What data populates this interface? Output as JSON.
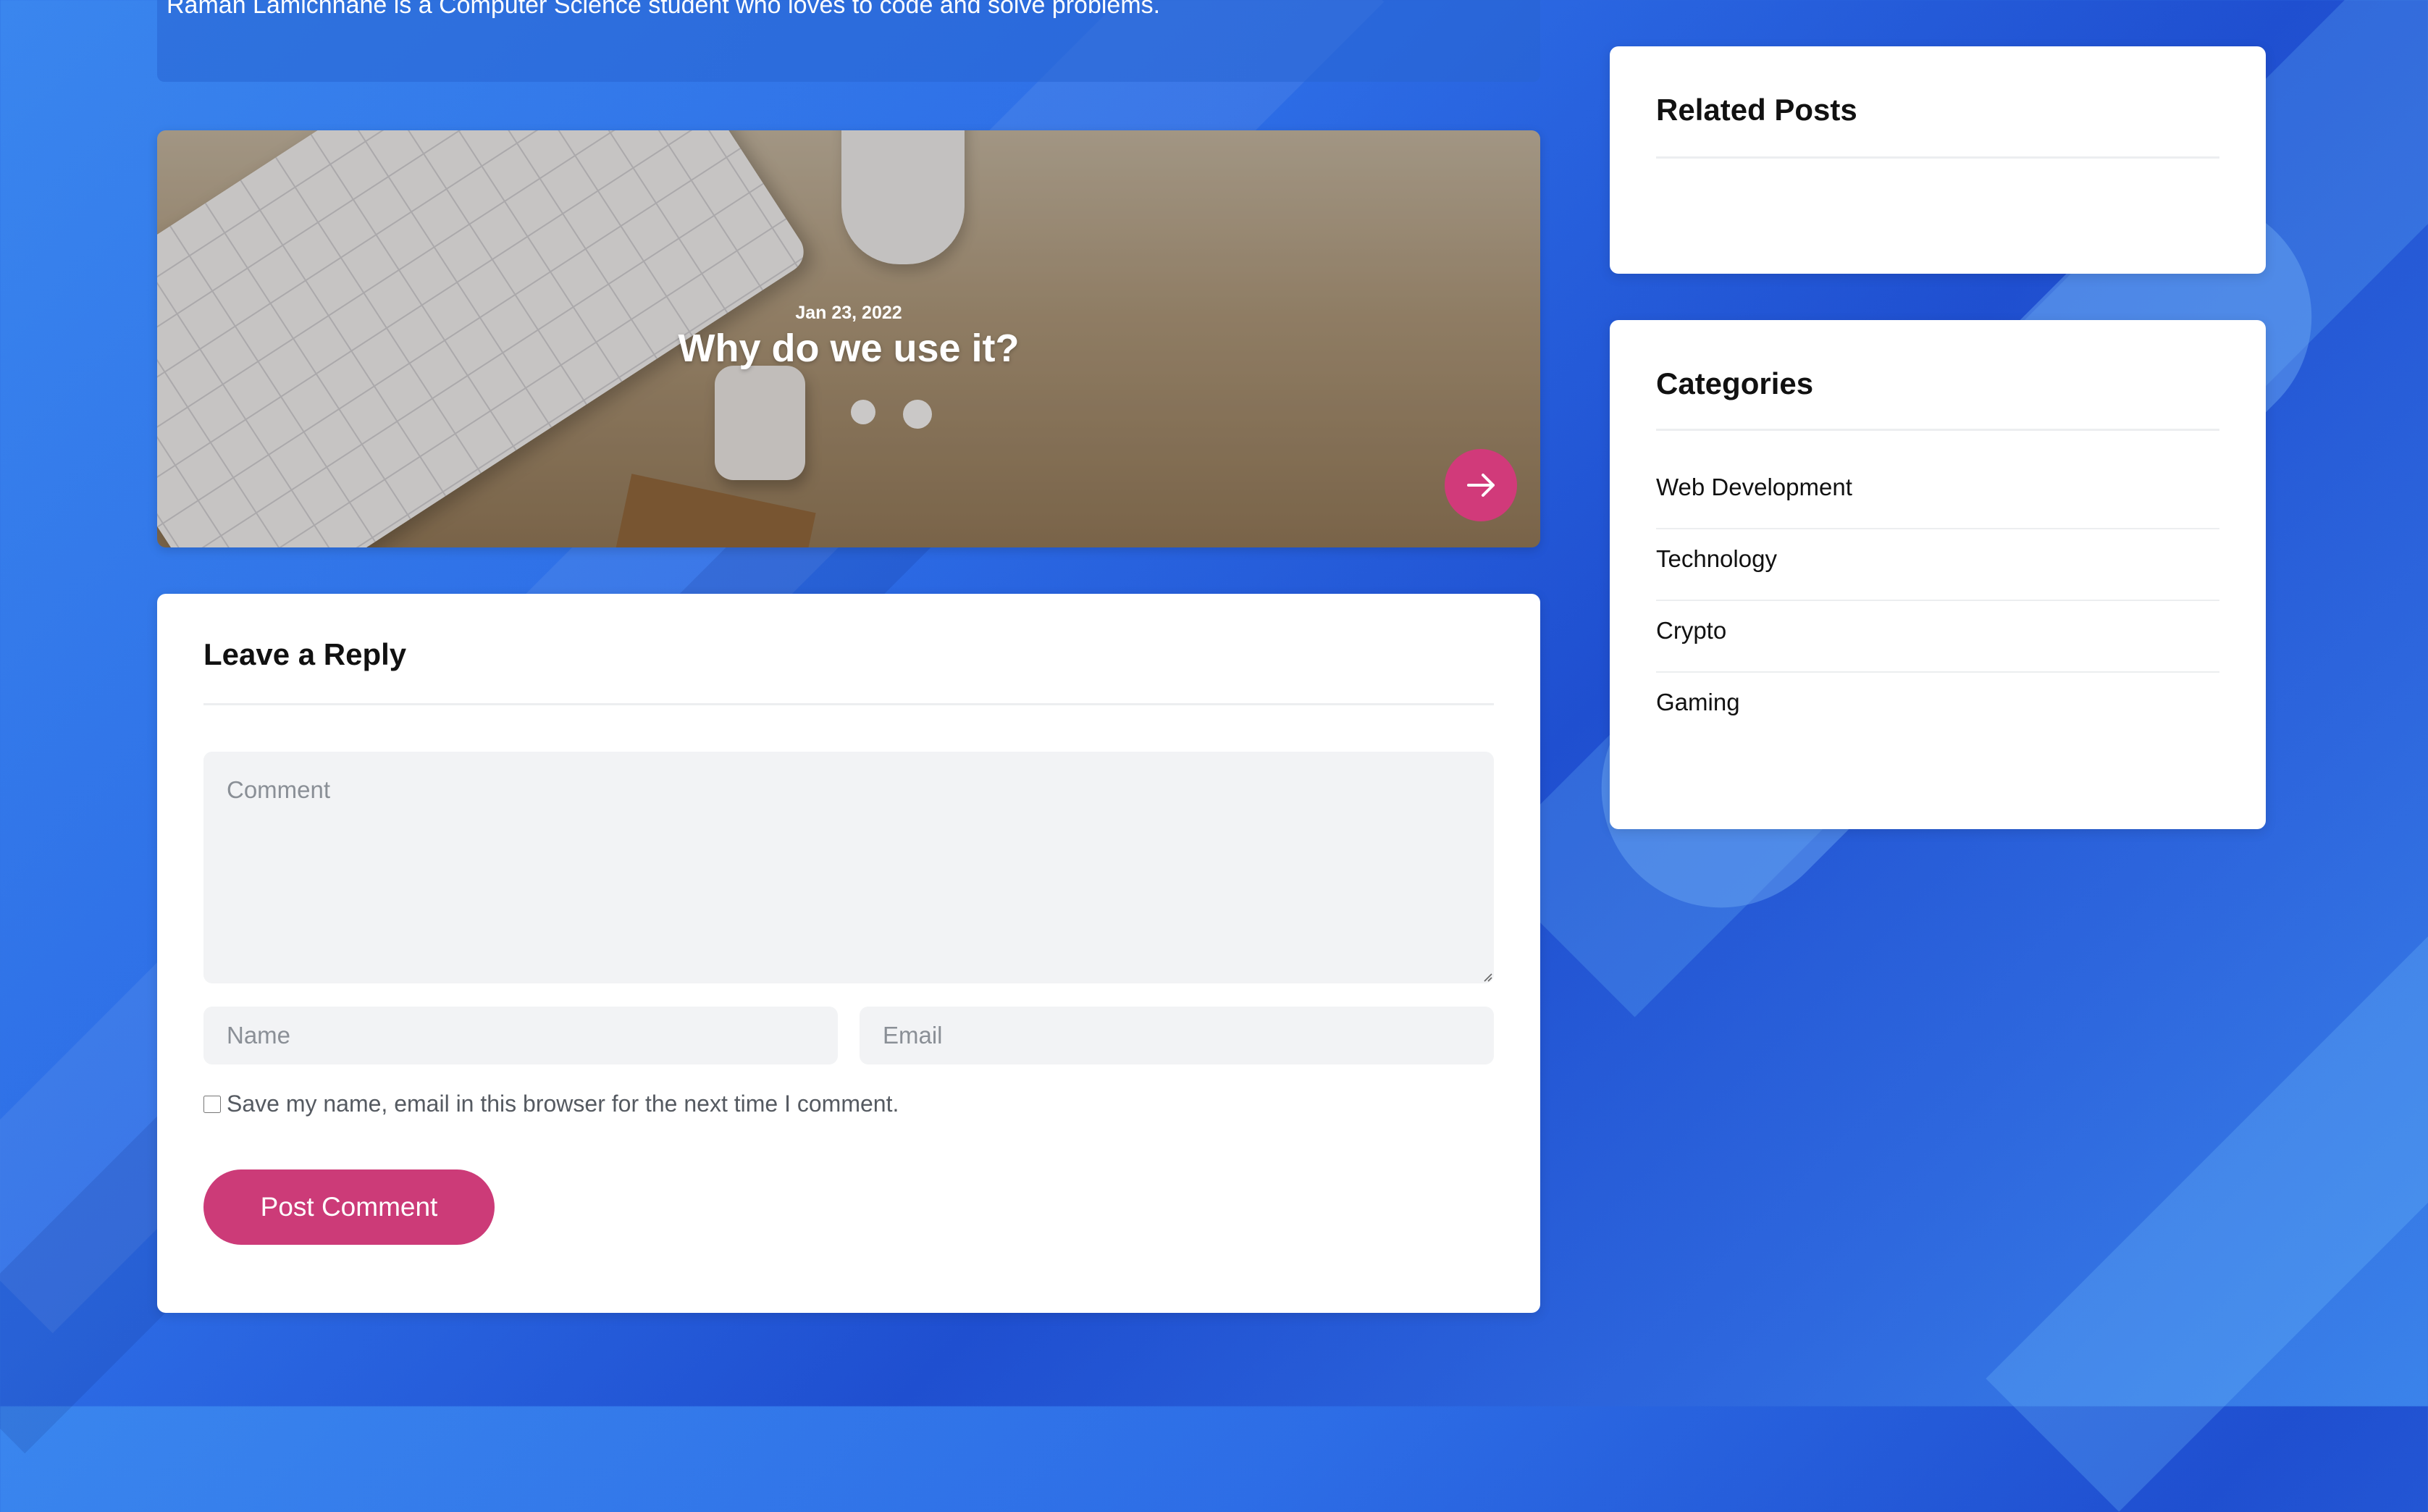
{
  "author": {
    "bio": "Raman Lamichhane is a Computer Science student who loves to code and solve problems."
  },
  "post_card": {
    "date": "Jan 23, 2022",
    "title": "Why do we use it?"
  },
  "reply_form": {
    "heading": "Leave a Reply",
    "comment_placeholder": "Comment",
    "name_placeholder": "Name",
    "email_placeholder": "Email",
    "save_label": "Save my name, email in this browser for the next time I comment.",
    "submit_label": "Post Comment"
  },
  "sidebar": {
    "related_heading": "Related Posts",
    "categories_heading": "Categories",
    "categories": [
      "Web Development",
      "Technology",
      "Crypto",
      "Gaming"
    ]
  },
  "colors": {
    "accent": "#cc3b78",
    "background": "#2d6de6"
  },
  "icons": {
    "read_more": "arrow-right-icon"
  }
}
